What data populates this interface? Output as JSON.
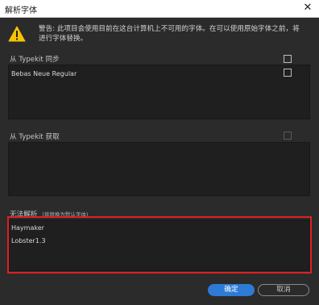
{
  "window": {
    "title": "解析字体",
    "close_glyph": "✕"
  },
  "warning": {
    "icon": "warning-triangle-icon",
    "text": "警告: 此项目会使用目前在这台计算机上不可用的字体。在可以使用原始字体之前，将进行字体替换。"
  },
  "sections": {
    "typekit_sync": {
      "label": "从 Typekit 同步",
      "items": [
        {
          "name": "Bebas Neue Regular"
        }
      ]
    },
    "typekit_get": {
      "label": "从 Typekit 获取",
      "items": []
    },
    "unresolved": {
      "label": "无法解析",
      "sublabel": "(将替换为默认字体)",
      "items": [
        {
          "name": "Haymaker"
        },
        {
          "name": "Lobster1.3"
        }
      ]
    }
  },
  "buttons": {
    "ok": "确定",
    "cancel": "取消"
  },
  "colors": {
    "accent": "#2d7bd6",
    "highlight": "#e02020",
    "warning": "#f5c400"
  }
}
